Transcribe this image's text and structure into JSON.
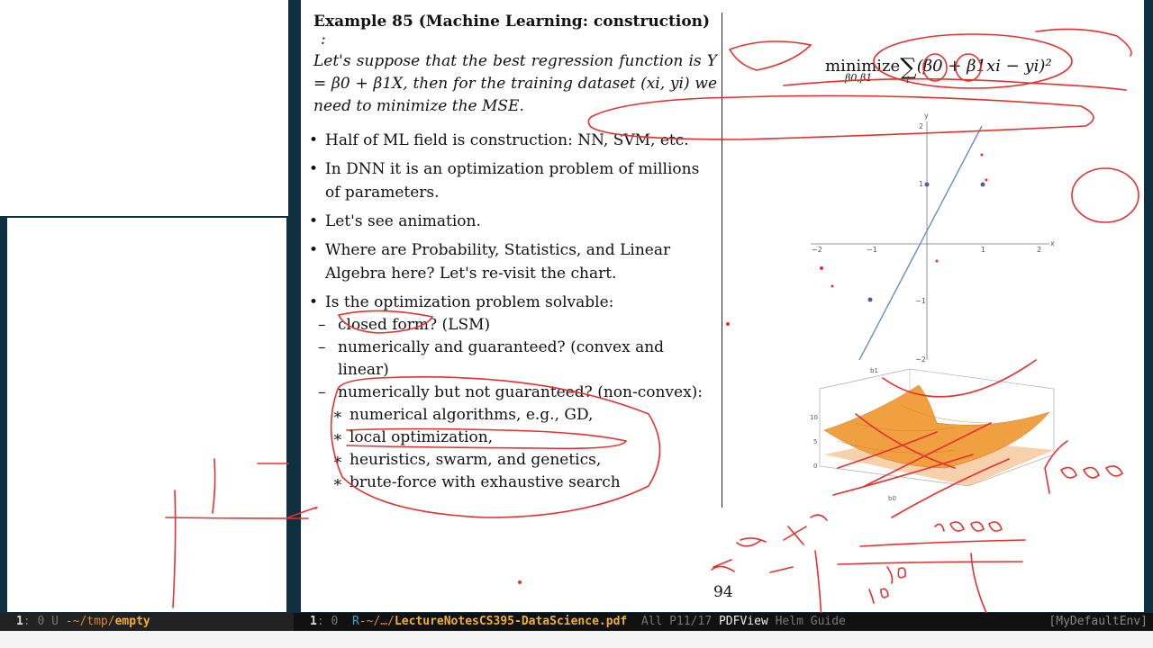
{
  "pdf": {
    "example_title": "Example 85 (Machine Learning: construction)",
    "example_colon": ":",
    "example_body": "Let's suppose that the best regression function is Y = β0 + β1X, then for the training dataset (xi, yi) we need to minimize the MSE.",
    "bullets": [
      "Half of ML field is construction: NN, SVM, etc.",
      "In DNN it is an optimization problem of millions of parameters.",
      "Let's see animation.",
      "Where are Probability, Statistics, and Linear Algebra here? Let's re-visit the chart.",
      "Is the optimization problem solvable:"
    ],
    "sub_items": [
      "closed form? (LSM)",
      "numerically and guaranteed? (convex and linear)",
      "numerically but not guaranteed? (non-convex):"
    ],
    "subsub_items": [
      "numerical algorithms, e.g., GD,",
      "local optimization,",
      "heuristics, swarm, and genetics,",
      "brute-force with exhaustive search"
    ],
    "formula": {
      "minimize": "minimize",
      "subscript": "β0,β1",
      "sum": "∑",
      "sum_index": "i",
      "expression": "(β0 + β1xi − yi)²"
    },
    "page_number": "94",
    "plot2d": {
      "x_label": "x",
      "y_label": "y",
      "x_ticks": [
        "−2",
        "−1",
        "1",
        "2"
      ],
      "y_ticks": [
        "2",
        "1",
        "−1",
        "−2"
      ],
      "line_color": "#6a8fbf",
      "point_color": "#5a5aa0"
    },
    "plot3d": {
      "labels": [
        "b1",
        "b0",
        "10",
        "5",
        "0"
      ],
      "surface_color": "#f0a040"
    },
    "ink": {
      "color": "#e53030",
      "handwritten": [
        "1000",
        "1000",
        "x",
        "x",
        "16"
      ]
    }
  },
  "modeline_left": {
    "num": "1",
    "state": ": 0 U ",
    "dir": "-~/tmp/",
    "buffer": "empty"
  },
  "modeline_right": {
    "num": "1",
    "state": ": 0  ",
    "r": "R",
    "dir": "-~/…/",
    "file": "LectureNotesCS395-DataScience.pdf",
    "pos": "All P11/17",
    "mode": "PDFView",
    "minor": "Helm Guide",
    "env": "[MyDefaultEnv]"
  }
}
